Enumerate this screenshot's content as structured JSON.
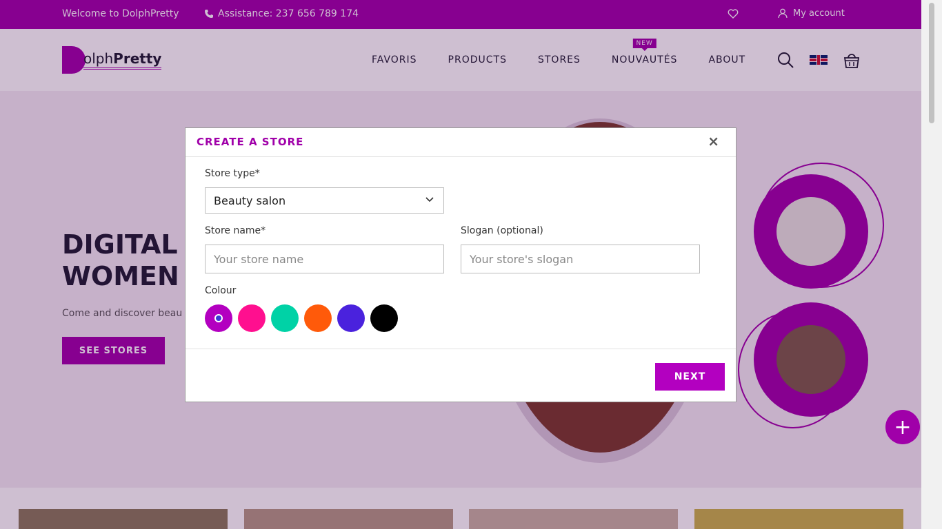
{
  "topbar": {
    "welcome": "Welcome to DolphPretty",
    "assistance": "Assistance: 237 656 789 174",
    "account": "My account"
  },
  "header": {
    "logo_initial": "D",
    "logo_rest": "olph",
    "logo_bold": "Pretty",
    "nav": [
      "FAVORIS",
      "PRODUCTS",
      "STORES",
      "NOUVAUTÉS",
      "ABOUT"
    ],
    "new_badge": "NEW"
  },
  "hero": {
    "title_line1": "DIGITAL IN",
    "title_line2": "WOMEN B",
    "subtitle": "Come and discover beau",
    "cta": "SEE STORES"
  },
  "modal": {
    "title": "CREATE A STORE",
    "close": "×",
    "store_type_label": "Store type*",
    "store_type_value": "Beauty salon",
    "store_name_label": "Store name*",
    "store_name_placeholder": "Your store name",
    "slogan_label": "Slogan (optional)",
    "slogan_placeholder": "Your store's slogan",
    "colour_label": "Colour",
    "colours": [
      "#b300c0",
      "#ff0f8f",
      "#00d2a6",
      "#ff5a0a",
      "#4a22dd",
      "#000000"
    ],
    "selected_colour_index": 0,
    "next": "NEXT"
  },
  "fab": "+"
}
